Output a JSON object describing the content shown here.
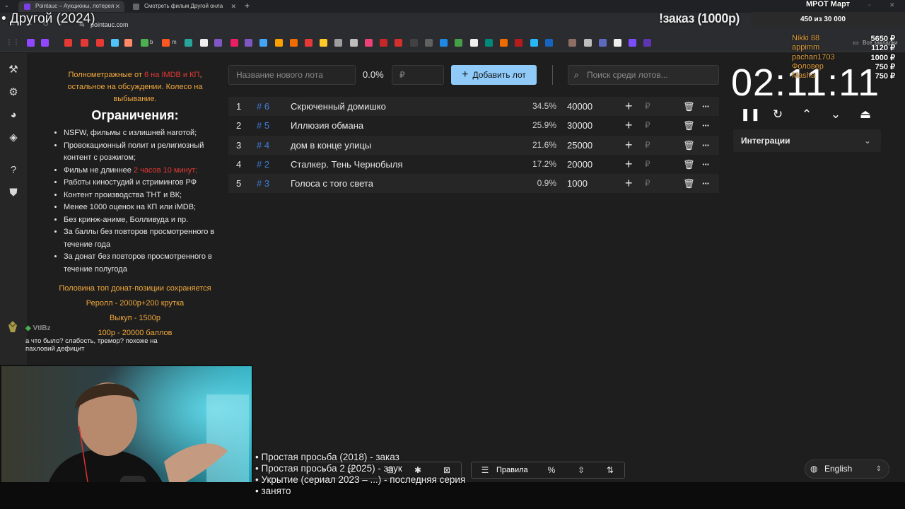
{
  "browser": {
    "tabs": [
      {
        "title": "Pointauc – Аукционы, лотерея"
      },
      {
        "title": "Смотреть фильм Другой онла"
      }
    ],
    "url": "pointauc.com",
    "bookmark_labels": [
      "b",
      "m"
    ],
    "all_bookmarks_label": "Все закладки"
  },
  "overlay": {
    "title": "• Другой (2024)",
    "order_banner": "!заказ (1000р)",
    "goal": {
      "title": "МРОТ Март",
      "progress": "450 из 30 000"
    },
    "donors": [
      {
        "name": "Nikki 88",
        "amount": "5650 ₽"
      },
      {
        "name": "appimm",
        "amount": "1120 ₽"
      },
      {
        "name": "pachan1703",
        "amount": "1000 ₽"
      },
      {
        "name": "Фоловер",
        "amount": "750 ₽"
      },
      {
        "name": "Masha",
        "amount": "750 ₽"
      }
    ],
    "queue": [
      "• Простая просьба (2018) - заказ",
      "• Простая просьба 2 (2025) - заук",
      "• Укрытие (сериал 2023 – ...) - последняя серия",
      "• занято"
    ],
    "chat": {
      "user": "VtIBz",
      "message": "а что было? слабость, тремор? похоже на пахловий дефицит"
    }
  },
  "rules": {
    "intro_prefix": "Полнометражные от ",
    "intro_red": "6 на IMDB и КП",
    "intro_suffix": ", остальное на обсуждении. Колесо на выбывание.",
    "heading": "Ограничения:",
    "items": [
      "NSFW, фильмы с излишней наготой;",
      "Провокационный полит и религиозный контент с розжигом;",
      "Работы киностудий и стримингов РФ",
      "Контент производства ТНТ и ВК;",
      "Менее 1000 оценок на КП или iMDB;",
      "Без кринж-аниме, Болливуда и пр.",
      "За баллы без повторов просмотренного в течение года",
      "За донат без повторов просмотренного в течение полугода"
    ],
    "length_item_prefix": "Фильм не длиннее ",
    "length_item_red": "2 часов 10 минут;",
    "notes": [
      "Половина топ донат-позиции сохраняется",
      "Реролл - 2000р+200 крутка",
      "Выкуп - 1500р",
      "100р - 20000 баллов"
    ]
  },
  "controls": {
    "new_lot_placeholder": "Название нового лота",
    "percent": "0.0%",
    "amount_placeholder": "₽",
    "add_lot_label": "Добавить лот",
    "search_placeholder": "Поиск среди лотов..."
  },
  "lots": [
    {
      "index": "1",
      "id": "# 6",
      "name": "Скрюченный домишко",
      "percent": "34.5%",
      "amount": "40000"
    },
    {
      "index": "2",
      "id": "# 5",
      "name": "Иллюзия обмана",
      "percent": "25.9%",
      "amount": "30000"
    },
    {
      "index": "3",
      "id": "# 4",
      "name": "дом в конце улицы",
      "percent": "21.6%",
      "amount": "25000"
    },
    {
      "index": "4",
      "id": "# 2",
      "name": "Сталкер. Тень Чернобыля",
      "percent": "17.2%",
      "amount": "20000"
    },
    {
      "index": "5",
      "id": "# 3",
      "name": "Голоса с того света",
      "percent": "0.9%",
      "amount": "1000"
    }
  ],
  "currency_symbol": "₽",
  "timer": {
    "value": "02:11:11"
  },
  "integrations": {
    "label": "Интеграции"
  },
  "toolbar": {
    "rules_label": "Правила"
  },
  "language": {
    "value": "English"
  },
  "colors": {
    "accent": "#90caf9",
    "lot_id": "#3e7dd8",
    "warning": "#e53935",
    "highlight": "#f2a93b"
  }
}
